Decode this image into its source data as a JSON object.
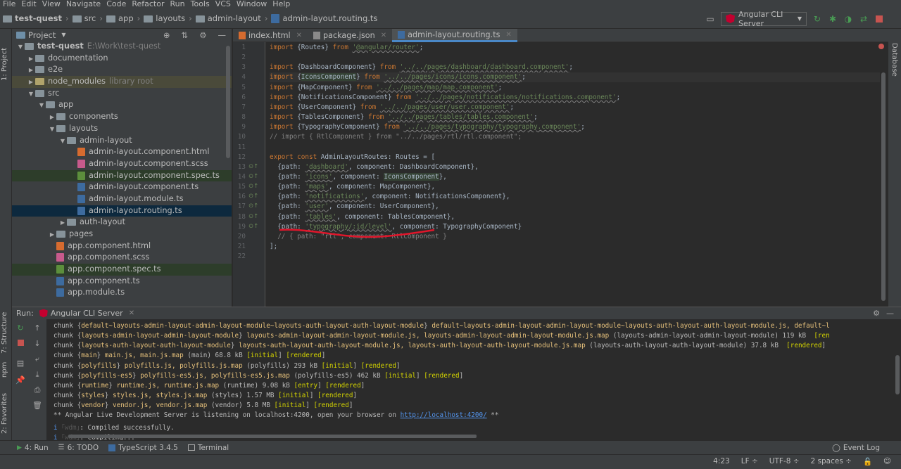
{
  "menu": [
    "File",
    "Edit",
    "View",
    "Navigate",
    "Code",
    "Refactor",
    "Run",
    "Tools",
    "VCS",
    "Window",
    "Help"
  ],
  "breadcrumb": [
    "test-quest",
    "src",
    "app",
    "layouts",
    "admin-layout",
    "admin-layout.routing.ts"
  ],
  "run_config": "Angular CLI Server",
  "project_panel": {
    "title": "Project"
  },
  "tree": [
    {
      "label": "test-quest",
      "extra": "E:\\Work\\test-quest",
      "depth": 0,
      "open": true,
      "kind": "folder"
    },
    {
      "label": "documentation",
      "depth": 1,
      "open": false,
      "kind": "folder"
    },
    {
      "label": "e2e",
      "depth": 1,
      "open": false,
      "kind": "folder"
    },
    {
      "label": "node_modules",
      "extra": "library root",
      "depth": 1,
      "open": false,
      "kind": "folder-yel"
    },
    {
      "label": "src",
      "depth": 1,
      "open": true,
      "kind": "folder"
    },
    {
      "label": "app",
      "depth": 2,
      "open": true,
      "kind": "folder"
    },
    {
      "label": "components",
      "depth": 3,
      "open": false,
      "kind": "folder"
    },
    {
      "label": "layouts",
      "depth": 3,
      "open": true,
      "kind": "folder"
    },
    {
      "label": "admin-layout",
      "depth": 4,
      "open": true,
      "kind": "folder"
    },
    {
      "label": "admin-layout.component.html",
      "depth": 5,
      "kind": "html"
    },
    {
      "label": "admin-layout.component.scss",
      "depth": 5,
      "kind": "scss"
    },
    {
      "label": "admin-layout.component.spec.ts",
      "depth": 5,
      "kind": "spec"
    },
    {
      "label": "admin-layout.component.ts",
      "depth": 5,
      "kind": "ts"
    },
    {
      "label": "admin-layout.module.ts",
      "depth": 5,
      "kind": "ts"
    },
    {
      "label": "admin-layout.routing.ts",
      "depth": 5,
      "kind": "ts-sel"
    },
    {
      "label": "auth-layout",
      "depth": 4,
      "open": false,
      "kind": "folder"
    },
    {
      "label": "pages",
      "depth": 3,
      "open": false,
      "kind": "folder"
    },
    {
      "label": "app.component.html",
      "depth": 3,
      "kind": "html"
    },
    {
      "label": "app.component.scss",
      "depth": 3,
      "kind": "scss"
    },
    {
      "label": "app.component.spec.ts",
      "depth": 3,
      "kind": "spec"
    },
    {
      "label": "app.component.ts",
      "depth": 3,
      "kind": "ts"
    },
    {
      "label": "app.module.ts",
      "depth": 3,
      "kind": "ts"
    }
  ],
  "tabs": [
    "index.html",
    "package.json",
    "admin-layout.routing.ts"
  ],
  "code_lines": [
    {
      "n": "1",
      "t": "import {Routes} from '@angular/router';"
    },
    {
      "n": "2",
      "t": ""
    },
    {
      "n": "3",
      "t": "import {DashboardComponent} from '../../pages/dashboard/dashboard.component';"
    },
    {
      "n": "4",
      "t": "import {IconsComponent} from '../../pages/icons/icons.component';"
    },
    {
      "n": "5",
      "t": "import {MapComponent} from '../../pages/map/map.component';"
    },
    {
      "n": "6",
      "t": "import {NotificationsComponent} from '../../pages/notifications/notifications.component';"
    },
    {
      "n": "7",
      "t": "import {UserComponent} from '../../pages/user/user.component';"
    },
    {
      "n": "8",
      "t": "import {TablesComponent} from '../../pages/tables/tables.component';"
    },
    {
      "n": "9",
      "t": "import {TypographyComponent} from '../../pages/typography/typography.component';"
    },
    {
      "n": "10",
      "t": "// import { RtlComponent } from \"../../pages/rtl/rtl.component\";"
    },
    {
      "n": "11",
      "t": ""
    },
    {
      "n": "12",
      "t": "export const AdminLayoutRoutes: Routes = ["
    },
    {
      "n": "13",
      "t": "  {path: 'dashboard', component: DashboardComponent},"
    },
    {
      "n": "14",
      "t": "  {path: 'icons', component: IconsComponent},"
    },
    {
      "n": "15",
      "t": "  {path: 'maps', component: MapComponent},"
    },
    {
      "n": "16",
      "t": "  {path: 'notifications', component: NotificationsComponent},"
    },
    {
      "n": "17",
      "t": "  {path: 'user', component: UserComponent},"
    },
    {
      "n": "18",
      "t": "  {path: 'tables', component: TablesComponent},"
    },
    {
      "n": "19",
      "t": "  {path: 'typography/:id/level', component: TypographyComponent}"
    },
    {
      "n": "20",
      "t": "  // { path: \"rtl\", component: RtlComponent }"
    },
    {
      "n": "21",
      "t": "];"
    },
    {
      "n": "22",
      "t": ""
    }
  ],
  "run_panel": {
    "label": "Run:",
    "config": "Angular CLI Server"
  },
  "console_lines": [
    "chunk {default~layouts-admin-layout-admin-layout-module~layouts-auth-layout-auth-layout-module} default~layouts-admin-layout-admin-layout-module~layouts-auth-layout-auth-layout-module.js, default~l",
    "chunk {layouts-admin-layout-admin-layout-module} layouts-admin-layout-admin-layout-module.js, layouts-admin-layout-admin-layout-module.js.map (layouts-admin-layout-admin-layout-module) 119 kB  [ren",
    "chunk {layouts-auth-layout-auth-layout-module} layouts-auth-layout-auth-layout-module.js, layouts-auth-layout-auth-layout-module.js.map (layouts-auth-layout-auth-layout-module) 37.8 kB  [rendered]",
    "chunk {main} main.js, main.js.map (main) 68.8 kB [initial] [rendered]",
    "chunk {polyfills} polyfills.js, polyfills.js.map (polyfills) 293 kB [initial] [rendered]",
    "chunk {polyfills-es5} polyfills-es5.js, polyfills-es5.js.map (polyfills-es5) 462 kB [initial] [rendered]",
    "chunk {runtime} runtime.js, runtime.js.map (runtime) 9.08 kB [entry] [rendered]",
    "chunk {styles} styles.js, styles.js.map (styles) 1.57 MB [initial] [rendered]",
    "chunk {vendor} vendor.js, vendor.js.map (vendor) 5.8 MB [initial] [rendered]",
    "** Angular Live Development Server is listening on localhost:4200, open your browser on http://localhost:4200/ **",
    "i ｢wdm｣: Compiled successfully.",
    "i ｢wdm｣: Compiling..."
  ],
  "bottom_tabs": [
    "4: Run",
    "6: TODO",
    "TypeScript 3.4.5",
    "Terminal",
    "Event Log"
  ],
  "left_strip": [
    "1: Project",
    "7: Structure",
    "npm",
    "2: Favorites"
  ],
  "right_strip": [
    "Database"
  ],
  "status": {
    "position": "4:23",
    "line_sep": "LF",
    "encoding": "UTF-8",
    "indent": "2 spaces"
  }
}
